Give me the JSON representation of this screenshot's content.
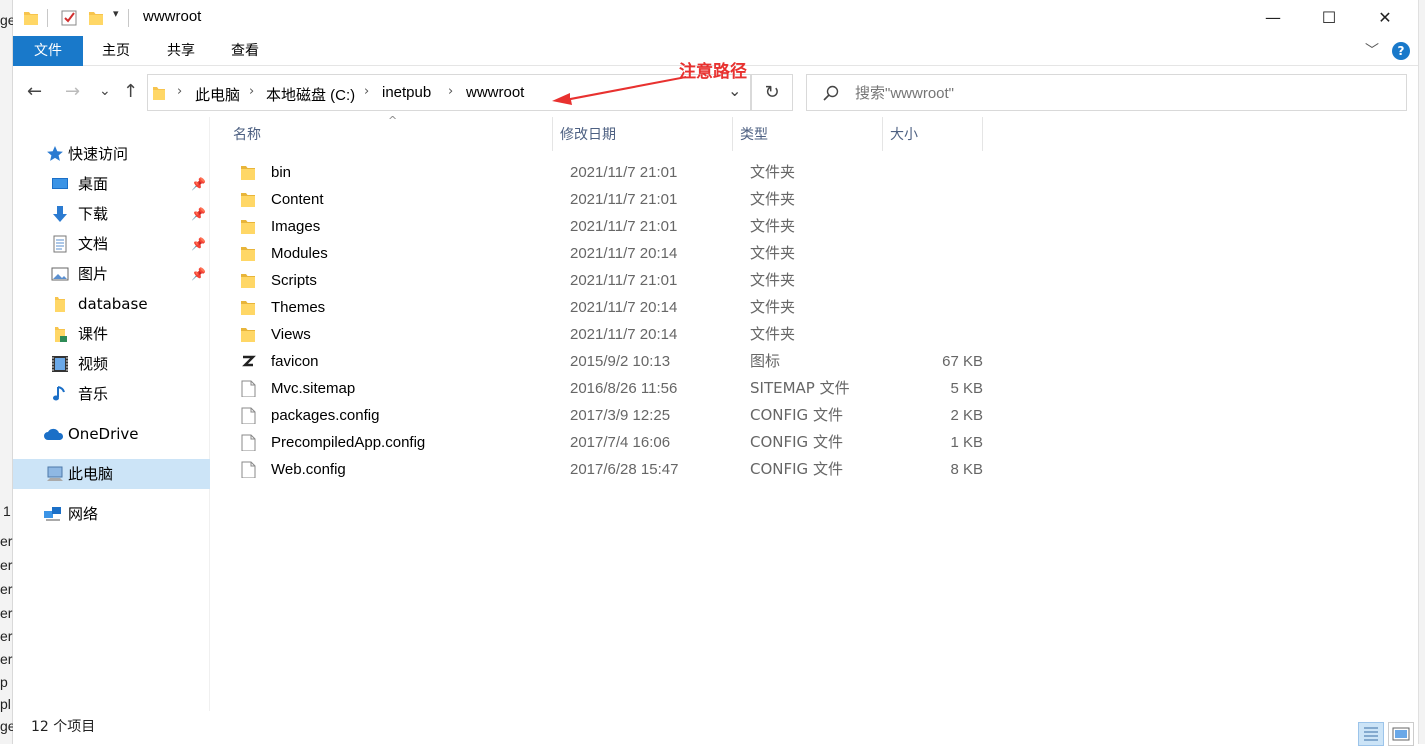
{
  "window": {
    "title": "wwwroot",
    "minimize_glyph": "—",
    "maximize_glyph": "☐",
    "close_glyph": "✕"
  },
  "background_text": [
    "ge",
    "1",
    "er",
    "er",
    "er",
    "er",
    "er",
    "er",
    "p",
    "pl",
    "ge"
  ],
  "ribbon": {
    "tabs": [
      "文件",
      "主页",
      "共享",
      "查看"
    ],
    "expand_glyph": "﹀",
    "help_glyph": "?"
  },
  "nav": {
    "back": "←",
    "forward": "→",
    "recent": "⌄",
    "up": "↑"
  },
  "address": {
    "crumbs": [
      "此电脑",
      "本地磁盘 (C:)",
      "inetpub",
      "wwwroot"
    ],
    "sep": "›",
    "dropdown": "⌄",
    "refresh": "↻"
  },
  "search": {
    "placeholder": "搜索\"wwwroot\"",
    "icon": "search-icon"
  },
  "annotation": "注意路径",
  "sidebar": {
    "items": [
      {
        "label": "快速访问",
        "icon": "star-icon"
      },
      {
        "label": "桌面",
        "icon": "desktop-icon",
        "pinned": true
      },
      {
        "label": "下载",
        "icon": "download-icon",
        "pinned": true
      },
      {
        "label": "文档",
        "icon": "document-icon",
        "pinned": true
      },
      {
        "label": "图片",
        "icon": "picture-icon",
        "pinned": true
      },
      {
        "label": "database",
        "icon": "folder-icon"
      },
      {
        "label": "课件",
        "icon": "folder-icon"
      },
      {
        "label": "视频",
        "icon": "video-icon"
      },
      {
        "label": "音乐",
        "icon": "music-icon"
      },
      {
        "label": "OneDrive",
        "icon": "cloud-icon"
      },
      {
        "label": "此电脑",
        "icon": "computer-icon",
        "selected": true
      },
      {
        "label": "网络",
        "icon": "network-icon"
      }
    ],
    "pin_glyph": "📌"
  },
  "columns": {
    "sort_glyph": "^",
    "name": "名称",
    "date": "修改日期",
    "type": "类型",
    "size": "大小"
  },
  "files": [
    {
      "name": "bin",
      "date": "2021/11/7 21:01",
      "type": "文件夹",
      "size": "",
      "icon": "folder-icon"
    },
    {
      "name": "Content",
      "date": "2021/11/7 21:01",
      "type": "文件夹",
      "size": "",
      "icon": "folder-icon"
    },
    {
      "name": "Images",
      "date": "2021/11/7 21:01",
      "type": "文件夹",
      "size": "",
      "icon": "folder-icon"
    },
    {
      "name": "Modules",
      "date": "2021/11/7 20:14",
      "type": "文件夹",
      "size": "",
      "icon": "folder-icon"
    },
    {
      "name": "Scripts",
      "date": "2021/11/7 21:01",
      "type": "文件夹",
      "size": "",
      "icon": "folder-icon"
    },
    {
      "name": "Themes",
      "date": "2021/11/7 20:14",
      "type": "文件夹",
      "size": "",
      "icon": "folder-icon"
    },
    {
      "name": "Views",
      "date": "2021/11/7 20:14",
      "type": "文件夹",
      "size": "",
      "icon": "folder-icon"
    },
    {
      "name": "favicon",
      "date": "2015/9/2 10:13",
      "type": "图标",
      "size": "67 KB",
      "icon": "favicon-icon"
    },
    {
      "name": "Mvc.sitemap",
      "date": "2016/8/26 11:56",
      "type": "SITEMAP 文件",
      "size": "5 KB",
      "icon": "file-icon"
    },
    {
      "name": "packages.config",
      "date": "2017/3/9 12:25",
      "type": "CONFIG 文件",
      "size": "2 KB",
      "icon": "file-icon"
    },
    {
      "name": "PrecompiledApp.config",
      "date": "2017/7/4 16:06",
      "type": "CONFIG 文件",
      "size": "1 KB",
      "icon": "file-icon"
    },
    {
      "name": "Web.config",
      "date": "2017/6/28 15:47",
      "type": "CONFIG 文件",
      "size": "8 KB",
      "icon": "file-icon"
    }
  ],
  "status": {
    "count": "12 个项目"
  },
  "colors": {
    "accent": "#1979ca",
    "selection": "#cce4f7",
    "folder": "#f7c44d",
    "annotation": "#e8312f"
  }
}
